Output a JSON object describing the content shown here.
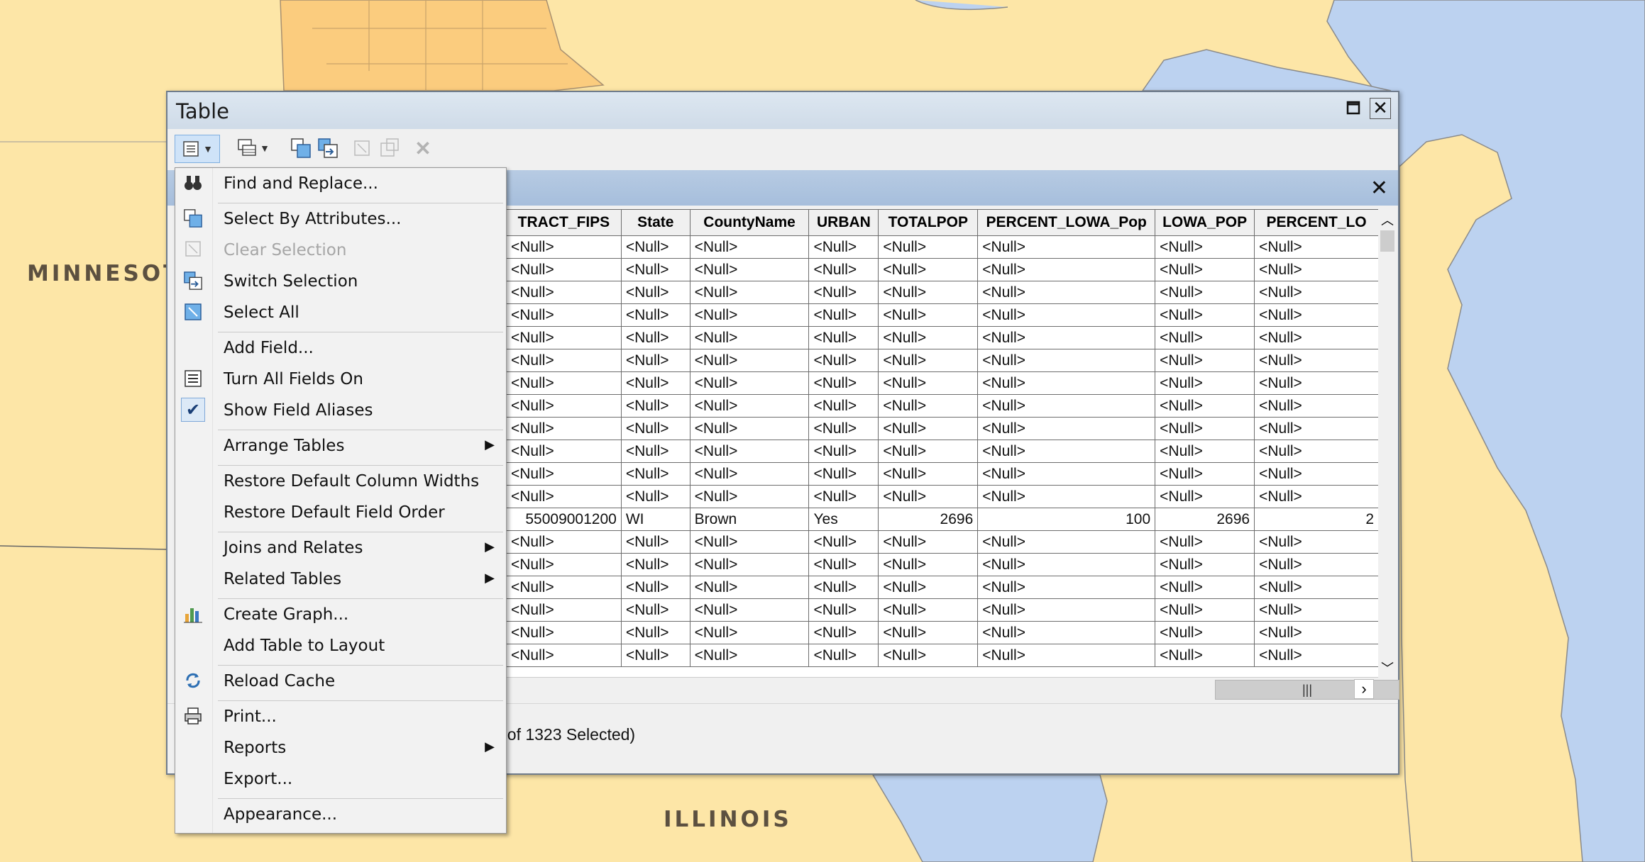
{
  "map": {
    "labels": {
      "minnesota": "MINNESOT",
      "illinois": "ILLINOIS"
    },
    "colors": {
      "land": "#fde6a7",
      "water": "#bcd2f0",
      "highlight": "#fbcc7e",
      "border": "#9a9a9a"
    }
  },
  "window": {
    "title": "Table",
    "maximize_icon": "maximize-icon",
    "close_icon": "close-icon",
    "toolbar": {
      "table_options": "table-options-icon",
      "related_tables": "related-tables-icon",
      "select_by_attributes": "select-by-attributes-icon",
      "switch_selection": "switch-selection-icon",
      "clear_selection": "clear-selection-icon",
      "delete_selected": "delete-selected-icon",
      "delete": "delete-icon"
    },
    "status": "t of 1323 Selected)"
  },
  "grid": {
    "columns": [
      "TRACT_FIPS",
      "State",
      "CountyName",
      "URBAN",
      "TOTALPOP",
      "PERCENT_LOWA_Pop",
      "LOWA_POP",
      "PERCENT_LO"
    ],
    "null_text": "<Null>",
    "selected_row": [
      "55009001200",
      "WI",
      "Brown",
      "Yes",
      "2696",
      "100",
      "2696",
      "2"
    ],
    "selected_row_index": 12,
    "row_count_visible": 19
  },
  "menu": {
    "items": [
      {
        "label": "Find and Replace...",
        "icon": "binoculars-icon",
        "enabled": true
      },
      {
        "label": "Select By Attributes...",
        "icon": "select-by-attributes-icon",
        "enabled": true
      },
      {
        "label": "Clear Selection",
        "icon": "clear-selection-icon",
        "enabled": false
      },
      {
        "label": "Switch Selection",
        "icon": "switch-selection-icon",
        "enabled": true
      },
      {
        "label": "Select All",
        "icon": "select-all-icon",
        "enabled": true
      },
      {
        "label": "Add Field...",
        "icon": "",
        "enabled": true
      },
      {
        "label": "Turn All Fields On",
        "icon": "fields-list-icon",
        "enabled": true
      },
      {
        "label": "Show Field Aliases",
        "icon": "checkmark-icon",
        "enabled": true,
        "checked": true
      },
      {
        "label": "Arrange Tables",
        "icon": "",
        "enabled": true,
        "submenu": true
      },
      {
        "label": "Restore Default Column Widths",
        "icon": "",
        "enabled": true
      },
      {
        "label": "Restore Default Field Order",
        "icon": "",
        "enabled": true
      },
      {
        "label": "Joins and Relates",
        "icon": "",
        "enabled": true,
        "submenu": true
      },
      {
        "label": "Related Tables",
        "icon": "",
        "enabled": true,
        "submenu": true
      },
      {
        "label": "Create Graph...",
        "icon": "bar-chart-icon",
        "enabled": true
      },
      {
        "label": "Add Table to Layout",
        "icon": "",
        "enabled": true
      },
      {
        "label": "Reload Cache",
        "icon": "reload-icon",
        "enabled": true
      },
      {
        "label": "Print...",
        "icon": "printer-icon",
        "enabled": true
      },
      {
        "label": "Reports",
        "icon": "",
        "enabled": true,
        "submenu": true
      },
      {
        "label": "Export...",
        "icon": "",
        "enabled": true
      },
      {
        "label": "Appearance...",
        "icon": "",
        "enabled": true
      }
    ]
  }
}
